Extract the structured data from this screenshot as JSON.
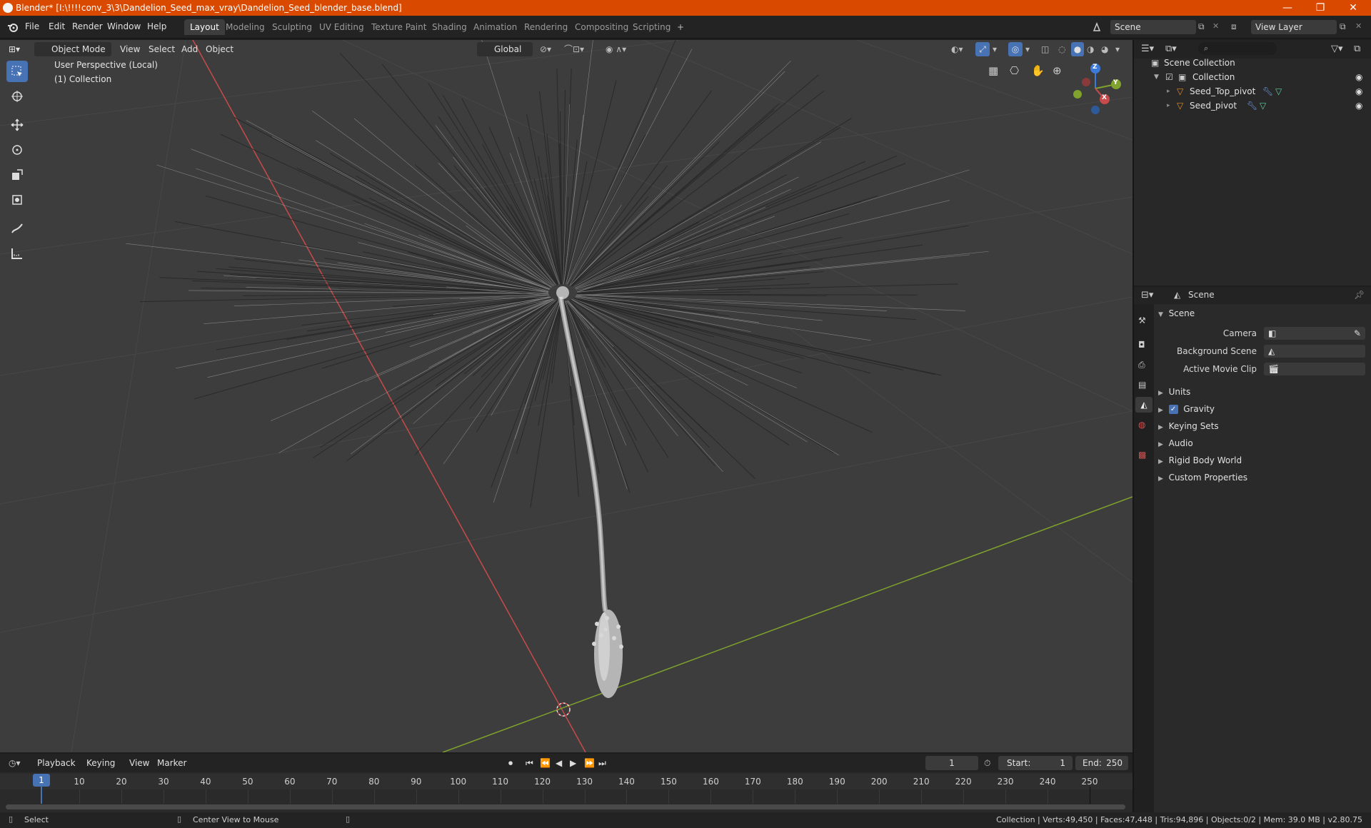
{
  "window": {
    "title": "Blender* [I:\\!!!!conv_3\\3\\Dandelion_Seed_max_vray\\Dandelion_Seed_blender_base.blend]",
    "minimize": "—",
    "maximize": "❐",
    "close": "✕"
  },
  "menu": [
    "File",
    "Edit",
    "Render",
    "Window",
    "Help"
  ],
  "workspaces": [
    "Layout",
    "Modeling",
    "Sculpting",
    "UV Editing",
    "Texture Paint",
    "Shading",
    "Animation",
    "Rendering",
    "Compositing",
    "Scripting"
  ],
  "active_workspace": "Layout",
  "add_workspace": "+",
  "scene_field": "Scene",
  "view_layer_field": "View Layer",
  "viewport": {
    "mode": "Object Mode",
    "menus": [
      "View",
      "Select",
      "Add",
      "Object"
    ],
    "orientation": "Global",
    "info_line1": "User Perspective (Local)",
    "info_line2": "(1) Collection",
    "gizmo": {
      "x": "X",
      "y": "Y",
      "z": "Z"
    }
  },
  "outliner": {
    "root": "Scene Collection",
    "collection": "Collection",
    "objects": [
      "Seed_Top_pivot",
      "Seed_pivot"
    ]
  },
  "properties": {
    "header": "Scene",
    "panel": "Scene",
    "camera_label": "Camera",
    "background_scene_label": "Background Scene",
    "active_movie_clip_label": "Active Movie Clip",
    "sections": [
      "Units",
      "Gravity",
      "Keying Sets",
      "Audio",
      "Rigid Body World",
      "Custom Properties"
    ]
  },
  "timeline": {
    "menus": [
      "Playback",
      "Keying",
      "View",
      "Marker"
    ],
    "current_frame": "1",
    "start_label": "Start:",
    "start": "1",
    "end_label": "End:",
    "end": "250",
    "ticks": [
      "1",
      "10",
      "20",
      "30",
      "40",
      "50",
      "60",
      "70",
      "80",
      "90",
      "100",
      "110",
      "120",
      "130",
      "140",
      "150",
      "160",
      "170",
      "180",
      "190",
      "200",
      "210",
      "220",
      "230",
      "240",
      "250"
    ]
  },
  "status": {
    "select": "Select",
    "center_view": "Center View to Mouse",
    "stats": "Collection | Verts:49,450 | Faces:47,448 | Tris:94,896 | Objects:0/2 | Mem: 39.0 MB | v2.80.75"
  },
  "colors": {
    "title_bar": "#d94a00",
    "accent": "#4772b3",
    "x_axis": "#c84a4a",
    "y_axis": "#7fa32c",
    "viewport_bg": "#3d3d3d"
  }
}
